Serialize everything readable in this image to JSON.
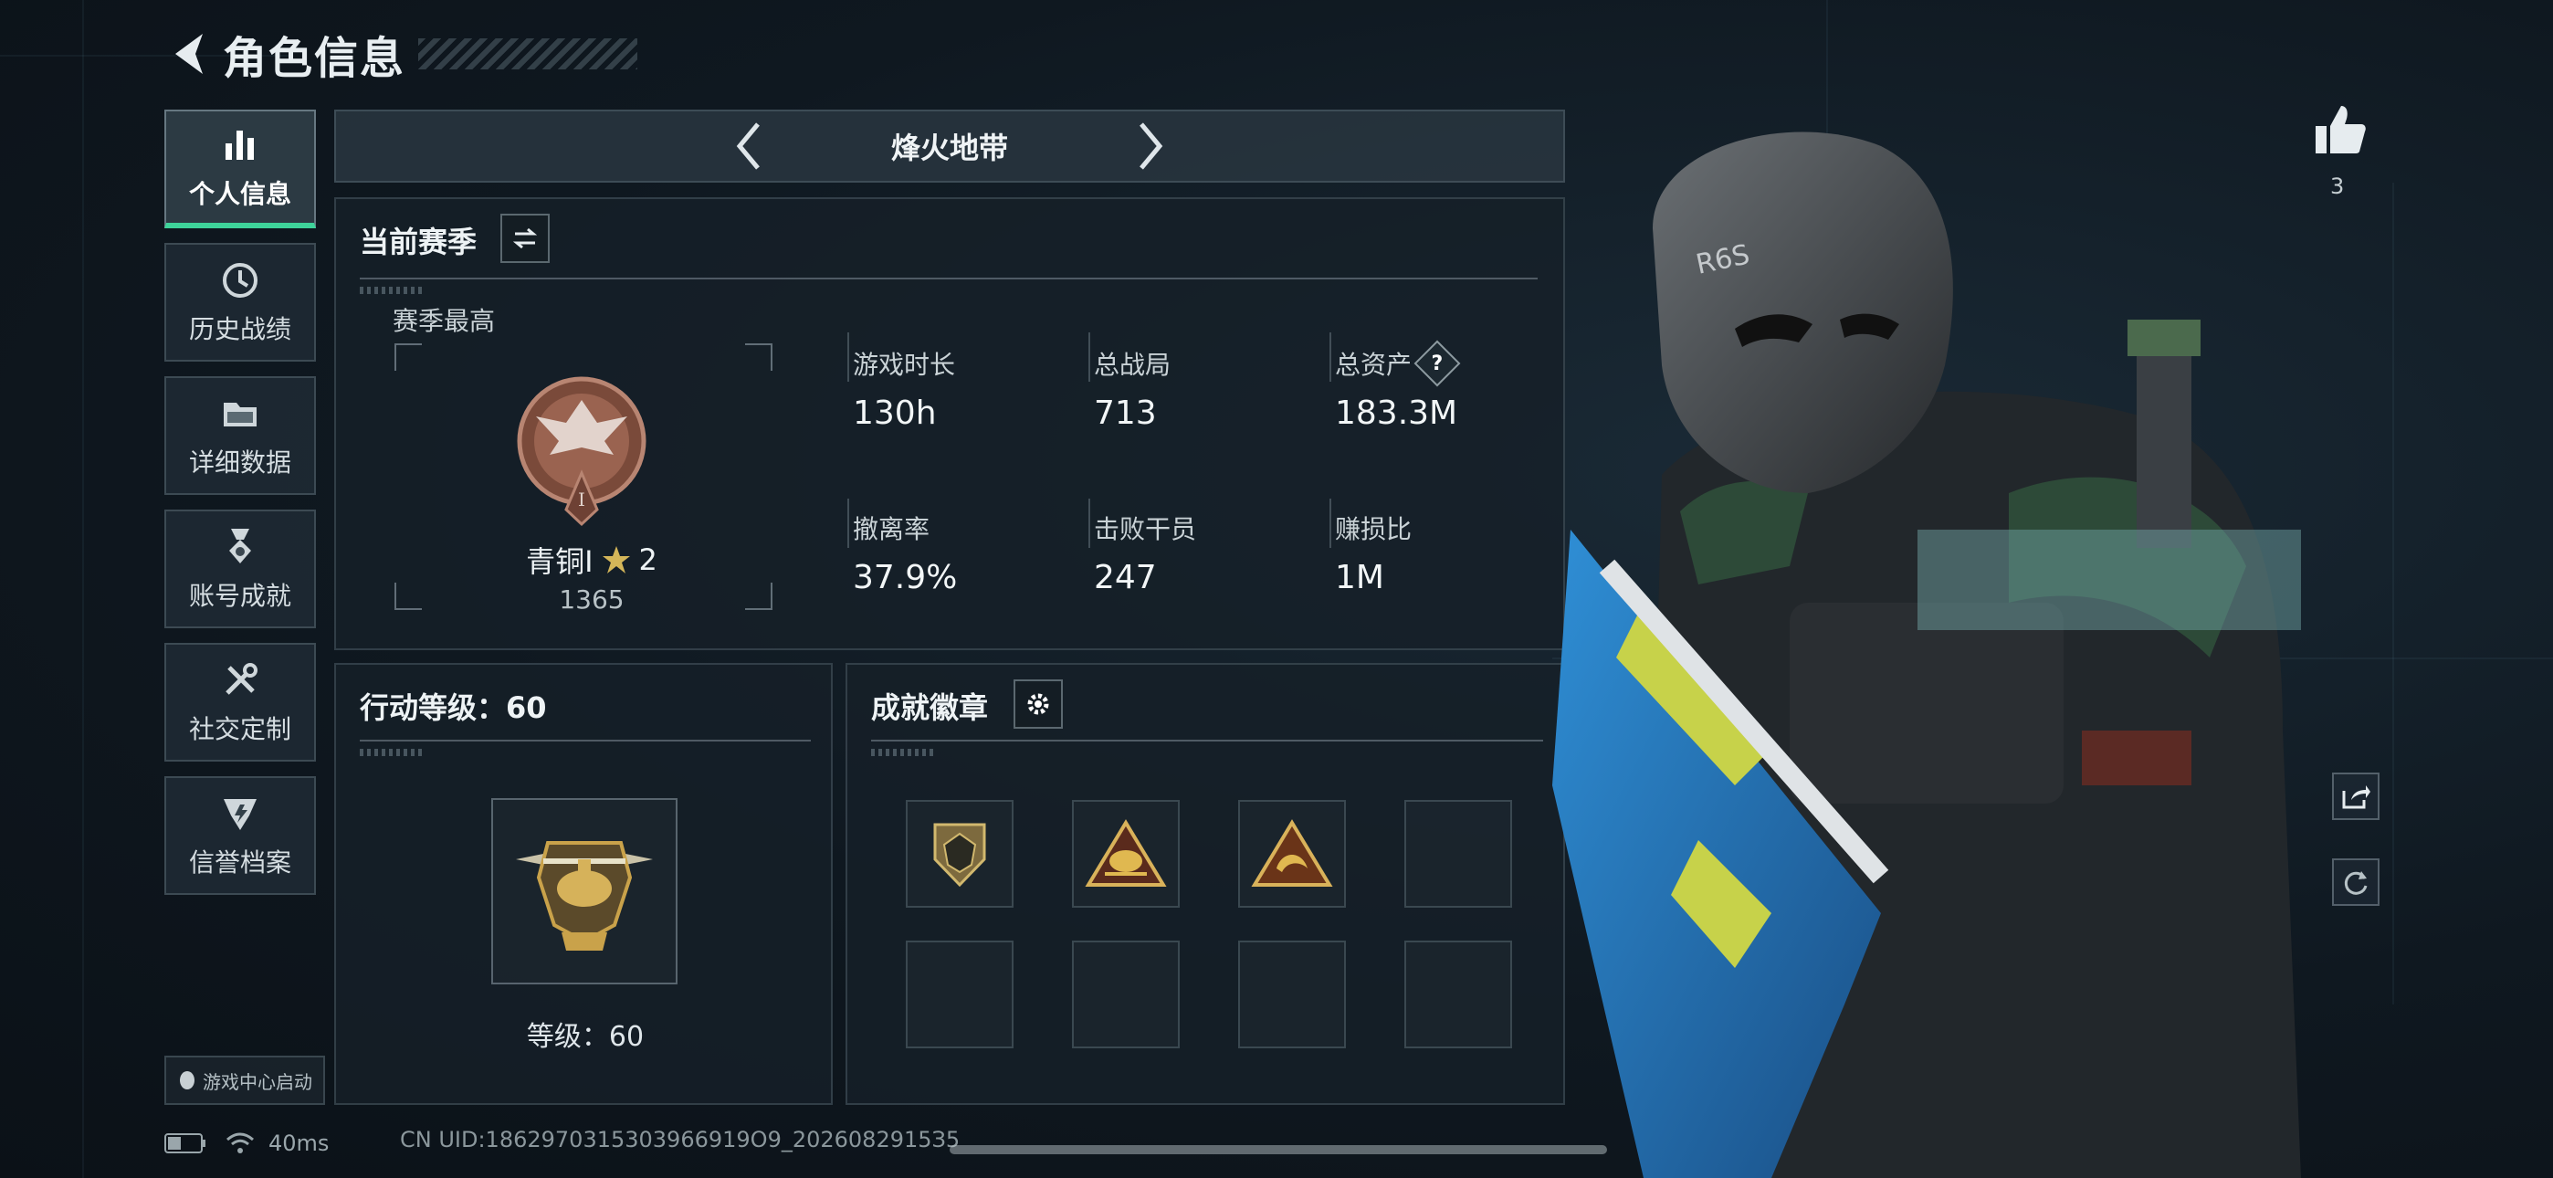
{
  "header": {
    "title": "角色信息"
  },
  "nav": {
    "items": [
      {
        "label": "个人信息",
        "icon": "bar-chart-icon",
        "active": true
      },
      {
        "label": "历史战绩",
        "icon": "history-clock-icon",
        "active": false
      },
      {
        "label": "详细数据",
        "icon": "folder-icon",
        "active": false
      },
      {
        "label": "账号成就",
        "icon": "medal-icon",
        "active": false
      },
      {
        "label": "社交定制",
        "icon": "tools-icon",
        "active": false
      },
      {
        "label": "信誉档案",
        "icon": "shield-badge-icon",
        "active": false
      }
    ],
    "launch_label": "游戏中心启动"
  },
  "mode": {
    "title": "烽火地带"
  },
  "season": {
    "title": "当前赛季",
    "best_label": "赛季最高",
    "rank_name": "青铜I",
    "rank_stars": "2",
    "rank_score": "1365",
    "stats": [
      {
        "label": "游戏时长",
        "value": "130h"
      },
      {
        "label": "总战局",
        "value": "713"
      },
      {
        "label": "总资产",
        "value": "183.3M",
        "help": "?"
      },
      {
        "label": "撤离率",
        "value": "37.9%"
      },
      {
        "label": "击败干员",
        "value": "247"
      },
      {
        "label": "赚损比",
        "value": "1M"
      }
    ]
  },
  "action": {
    "title_prefix": "行动等级：",
    "title_level": "60",
    "level_caption": "等级：60"
  },
  "achievements": {
    "title": "成就徽章",
    "badges": [
      "shield-d20-badge",
      "desert-triangle-badge",
      "dragon-triangle-badge",
      "",
      "",
      "",
      "",
      ""
    ]
  },
  "character": {
    "likes": "3",
    "mask_text": "R6S"
  },
  "status": {
    "ping": "40ms",
    "uid": "CN UID:1862970315303966919О9_2026082915З5"
  },
  "colors": {
    "accent": "#3ed39a",
    "panel": "#16202a",
    "gold": "#c9a24a"
  }
}
